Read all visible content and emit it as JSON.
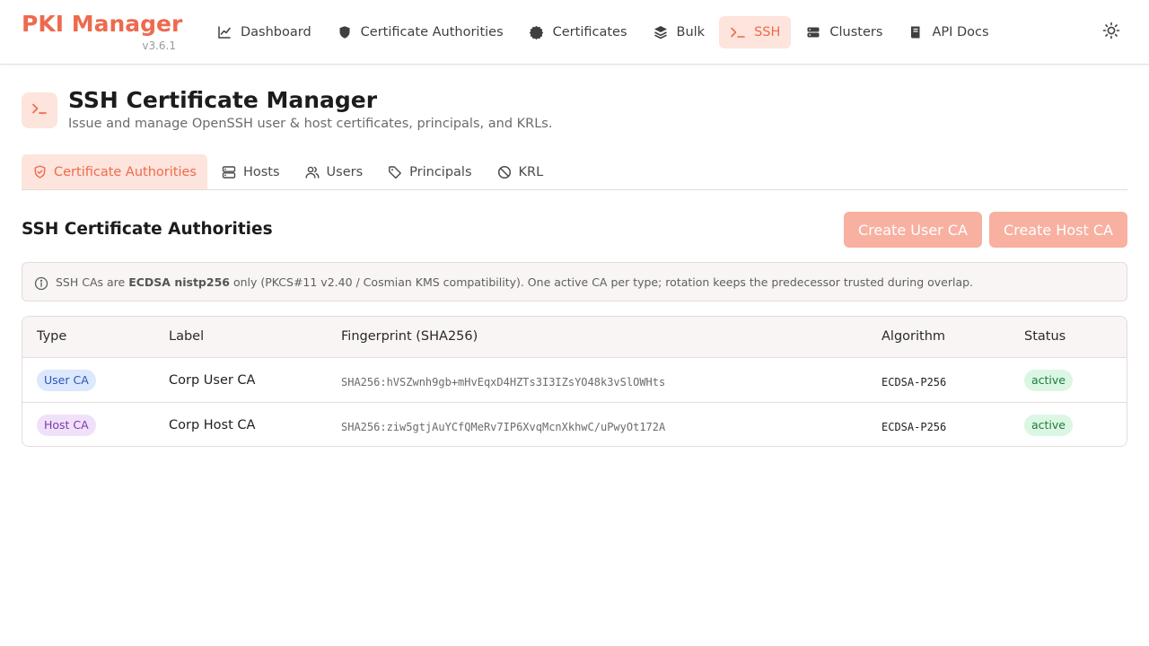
{
  "app": {
    "name": "PKI Manager",
    "version": "v3.6.1"
  },
  "colors": {
    "accent": "#ee6a4e",
    "accent_soft": "#fde4dc",
    "button_disabled": "#f8b0a1"
  },
  "nav": {
    "items": [
      {
        "label": "Dashboard",
        "icon": "chart-line-icon"
      },
      {
        "label": "Certificate Authorities",
        "icon": "shield-icon"
      },
      {
        "label": "Certificates",
        "icon": "badge-icon"
      },
      {
        "label": "Bulk",
        "icon": "layers-icon"
      },
      {
        "label": "SSH",
        "icon": "terminal-icon",
        "active": true
      },
      {
        "label": "Clusters",
        "icon": "server-icon"
      },
      {
        "label": "API Docs",
        "icon": "book-icon"
      }
    ],
    "theme_icon": "sun-icon"
  },
  "page": {
    "icon": "terminal-icon",
    "title": "SSH Certificate Manager",
    "subtitle": "Issue and manage OpenSSH user & host certificates, principals, and KRLs."
  },
  "tabs": [
    {
      "label": "Certificate Authorities",
      "icon": "shield-check-icon",
      "active": true
    },
    {
      "label": "Hosts",
      "icon": "server-icon"
    },
    {
      "label": "Users",
      "icon": "users-icon"
    },
    {
      "label": "Principals",
      "icon": "tag-icon"
    },
    {
      "label": "KRL",
      "icon": "ban-icon"
    }
  ],
  "section": {
    "title": "SSH Certificate Authorities",
    "create_user_ca": "Create User CA",
    "create_host_ca": "Create Host CA"
  },
  "info": {
    "prefix": "SSH CAs are ",
    "bold": "ECDSA nistp256",
    "suffix": " only (PKCS#11 v2.40 / Cosmian KMS compatibility). One active CA per type; rotation keeps the predecessor trusted during overlap."
  },
  "table": {
    "headers": {
      "type": "Type",
      "label": "Label",
      "fingerprint": "Fingerprint (SHA256)",
      "algorithm": "Algorithm",
      "status": "Status"
    },
    "rows": [
      {
        "type": "User CA",
        "label": "Corp User CA",
        "fingerprint": "SHA256:hVSZwnh9gb+mHvEqxD4HZTs3I3IZsYO48k3vSlOWHts",
        "algorithm": "ECDSA-P256",
        "status": "active"
      },
      {
        "type": "Host CA",
        "label": "Corp Host CA",
        "fingerprint": "SHA256:ziw5gtjAuYCfQMeRv7IP6XvqMcnXkhwC/uPwyOt172A",
        "algorithm": "ECDSA-P256",
        "status": "active"
      }
    ]
  }
}
